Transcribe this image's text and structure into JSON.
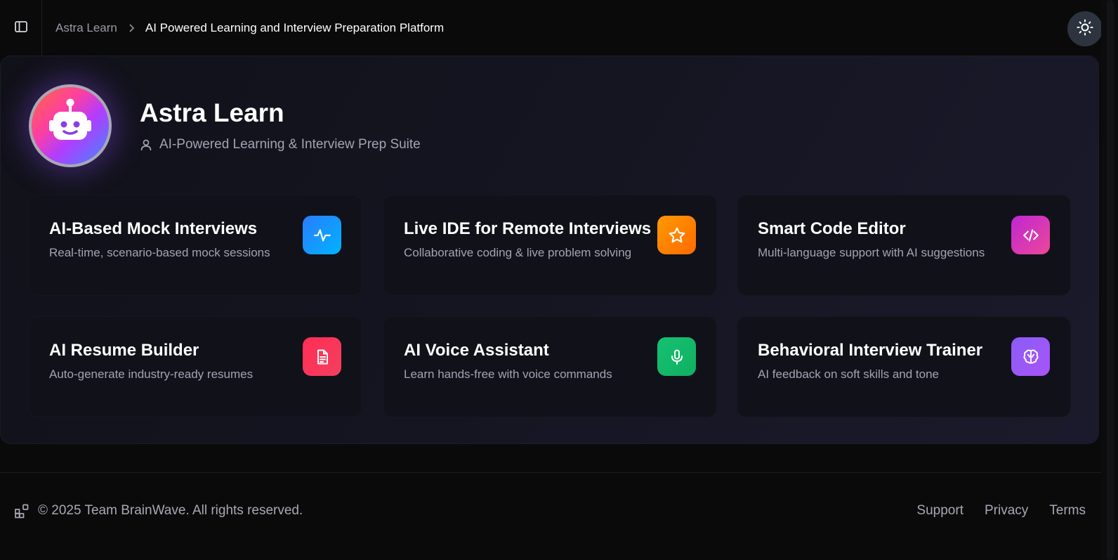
{
  "header": {
    "breadcrumb_root": "Astra Learn",
    "breadcrumb_current": "AI Powered Learning and Interview Preparation Platform"
  },
  "hero": {
    "title": "Astra Learn",
    "subtitle": "AI-Powered Learning & Interview Prep Suite",
    "avatar_icon": "robot-icon"
  },
  "features": [
    {
      "title": "AI-Based Mock Interviews",
      "desc": "Real-time, scenario-based mock sessions",
      "icon": "activity-icon",
      "color": "#1e8fff"
    },
    {
      "title": "Live IDE for Remote Interviews",
      "desc": "Collaborative coding & live problem solving",
      "icon": "star-icon",
      "color": "#ff8a00"
    },
    {
      "title": "Smart Code Editor",
      "desc": "Multi-language support with AI suggestions",
      "icon": "code-icon",
      "color": "#d946ef"
    },
    {
      "title": "AI Resume Builder",
      "desc": "Auto-generate industry-ready resumes",
      "icon": "document-icon",
      "color": "#ff2d55"
    },
    {
      "title": "AI Voice Assistant",
      "desc": "Learn hands-free with voice commands",
      "icon": "microphone-icon",
      "color": "#12c46b"
    },
    {
      "title": "Behavioral Interview Trainer",
      "desc": "AI feedback on soft skills and tone",
      "icon": "brain-icon",
      "color": "#9b4dff"
    }
  ],
  "footer": {
    "copyright": "© 2025 Team BrainWave. All rights reserved.",
    "links": [
      "Support",
      "Privacy",
      "Terms"
    ]
  }
}
